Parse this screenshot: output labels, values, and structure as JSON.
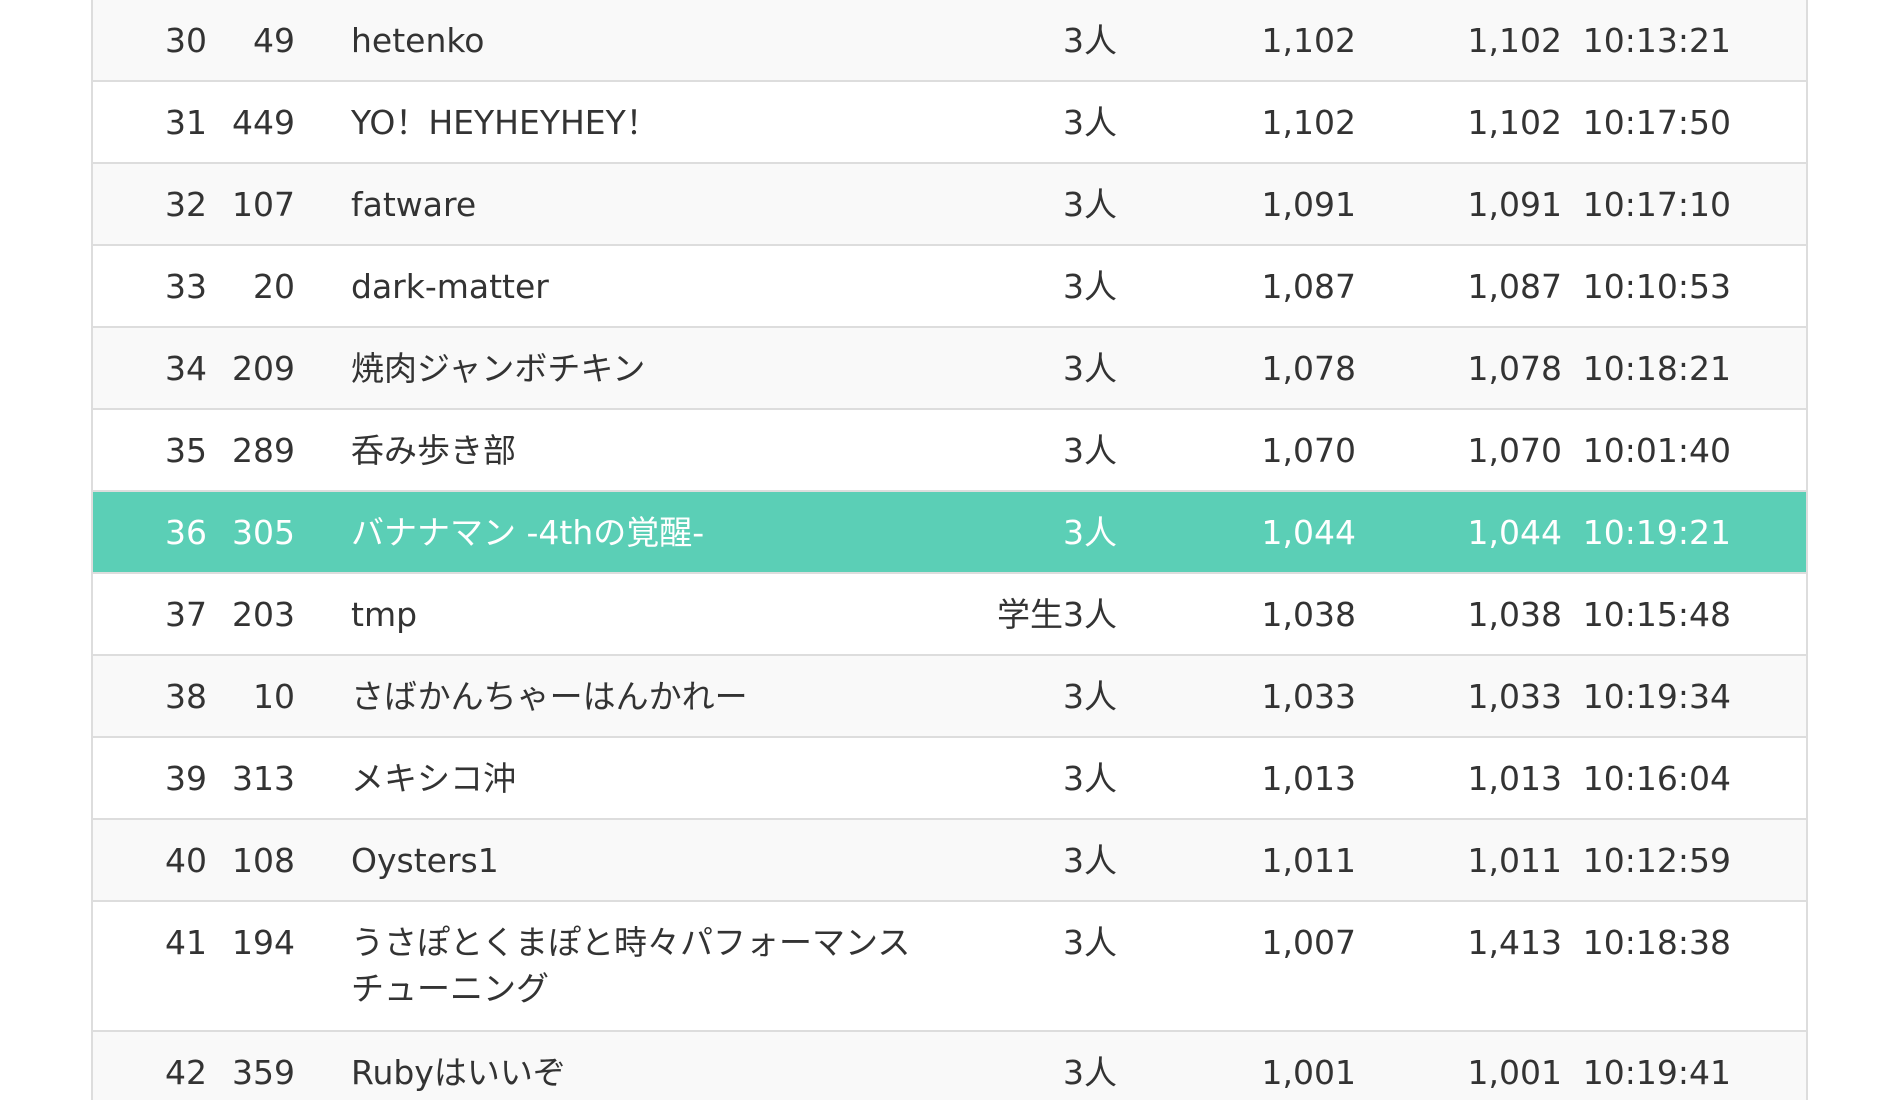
{
  "rows": [
    {
      "rank": "30",
      "id": "49",
      "name": "hetenko",
      "members": "3人",
      "score": "1,102",
      "best": "1,102",
      "time": "10:13:21"
    },
    {
      "rank": "31",
      "id": "449",
      "name": "YO！HEYHEYHEY！",
      "members": "3人",
      "score": "1,102",
      "best": "1,102",
      "time": "10:17:50"
    },
    {
      "rank": "32",
      "id": "107",
      "name": "fatware",
      "members": "3人",
      "score": "1,091",
      "best": "1,091",
      "time": "10:17:10"
    },
    {
      "rank": "33",
      "id": "20",
      "name": "dark-matter",
      "members": "3人",
      "score": "1,087",
      "best": "1,087",
      "time": "10:10:53"
    },
    {
      "rank": "34",
      "id": "209",
      "name": "焼肉ジャンボチキン",
      "members": "3人",
      "score": "1,078",
      "best": "1,078",
      "time": "10:18:21"
    },
    {
      "rank": "35",
      "id": "289",
      "name": "呑み歩き部",
      "members": "3人",
      "score": "1,070",
      "best": "1,070",
      "time": "10:01:40"
    },
    {
      "rank": "36",
      "id": "305",
      "name": "バナナマン -4thの覚醒-",
      "members": "3人",
      "score": "1,044",
      "best": "1,044",
      "time": "10:19:21"
    },
    {
      "rank": "37",
      "id": "203",
      "name": "tmp",
      "members": "学生3人",
      "score": "1,038",
      "best": "1,038",
      "time": "10:15:48"
    },
    {
      "rank": "38",
      "id": "10",
      "name": "さばかんちゃーはんかれー",
      "members": "3人",
      "score": "1,033",
      "best": "1,033",
      "time": "10:19:34"
    },
    {
      "rank": "39",
      "id": "313",
      "name": "メキシコ沖",
      "members": "3人",
      "score": "1,013",
      "best": "1,013",
      "time": "10:16:04"
    },
    {
      "rank": "40",
      "id": "108",
      "name": "Oysters1",
      "members": "3人",
      "score": "1,011",
      "best": "1,011",
      "time": "10:12:59"
    },
    {
      "rank": "41",
      "id": "194",
      "name": "うさぽとくまぽと時々パフォーマンスチューニング",
      "members": "3人",
      "score": "1,007",
      "best": "1,413",
      "time": "10:18:38"
    },
    {
      "rank": "42",
      "id": "359",
      "name": "Rubyはいいぞ",
      "members": "3人",
      "score": "1,001",
      "best": "1,001",
      "time": "10:19:41"
    }
  ],
  "highlight_color": "#5bcfb6"
}
